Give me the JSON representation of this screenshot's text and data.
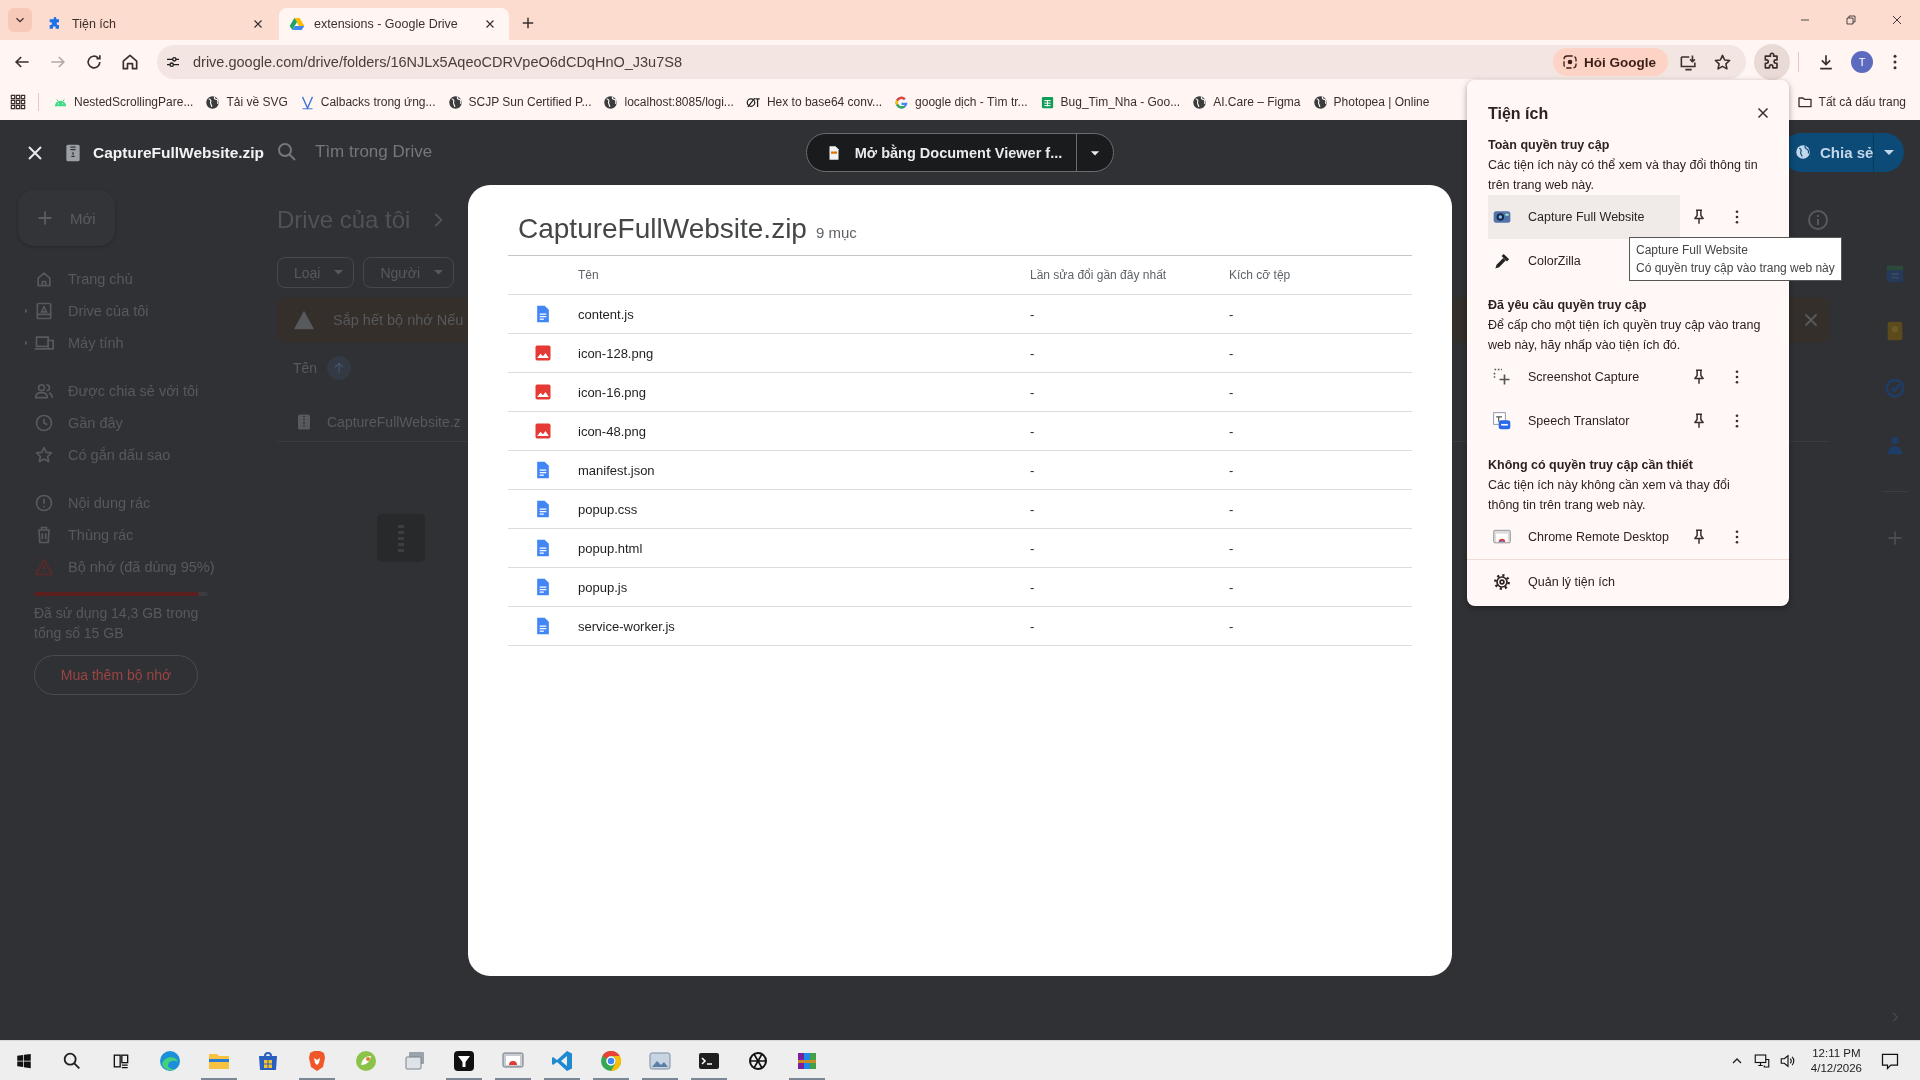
{
  "browser": {
    "tabs": [
      {
        "title": "Tiện ích",
        "selected": false
      },
      {
        "title": "extensions - Google Drive",
        "selected": true
      }
    ],
    "url": "drive.google.com/drive/folders/16NJLx5AqeoCDRVpeO6dCDqHnO_J3u7S8",
    "ask_google": "Hỏi Google",
    "profile_initial": "T",
    "bookmarks": [
      "NestedScrollingPare...",
      "Tải về SVG",
      "Calbacks trong ứng...",
      "SCJP Sun Certified P...",
      "localhost:8085/logi...",
      "Hex to base64 conv...",
      "google dịch - Tìm tr...",
      "Bug_Tim_Nha - Goo...",
      "AI.Care – Figma",
      "Photopea | Online"
    ],
    "all_bookmarks": "Tất cả dấu trang"
  },
  "drive": {
    "new_button": "Mới",
    "search_placeholder": "Tìm trong Drive",
    "share": "Chia sẻ",
    "nav_groups": [
      [
        {
          "label": "Trang chủ",
          "expandable": false
        },
        {
          "label": "Drive của tôi",
          "expandable": true
        },
        {
          "label": "Máy tính",
          "expandable": true
        }
      ],
      [
        {
          "label": "Được chia sẻ với tôi",
          "expandable": false
        },
        {
          "label": "Gần đây",
          "expandable": false
        },
        {
          "label": "Có gắn dấu sao",
          "expandable": false
        }
      ],
      [
        {
          "label": "Nội dung rác",
          "expandable": false
        },
        {
          "label": "Thùng rác",
          "expandable": false
        },
        {
          "label": "Bộ nhớ (đã dùng 95%)",
          "expandable": false
        }
      ]
    ],
    "storage": {
      "level": 0.95,
      "text": "Đã sử dụng 14,3 GB trong tổng số 15 GB"
    },
    "buy_storage": "Mua thêm bộ nhớ",
    "heading": "Drive của tôi",
    "filters": [
      "Loại",
      "Người"
    ],
    "banner": "Sắp hết bộ nhớ Nếu",
    "sort_label": "Tên",
    "files": [
      "CaptureFullWebsite.z"
    ]
  },
  "viewer": {
    "file_name": "CaptureFullWebsite.zip",
    "open_with": "Mở bằng Document Viewer f..."
  },
  "archive": {
    "title": "CaptureFullWebsite.zip",
    "count": "9 mục",
    "columns": [
      "Tên",
      "Lần sửa đổi gần đây nhất",
      "Kích cỡ tệp"
    ],
    "rows": [
      {
        "kind": "document",
        "name": "content.js",
        "modified": "-",
        "size": "-"
      },
      {
        "kind": "image",
        "name": "icon-128.png",
        "modified": "-",
        "size": "-"
      },
      {
        "kind": "image",
        "name": "icon-16.png",
        "modified": "-",
        "size": "-"
      },
      {
        "kind": "image",
        "name": "icon-48.png",
        "modified": "-",
        "size": "-"
      },
      {
        "kind": "document",
        "name": "manifest.json",
        "modified": "-",
        "size": "-"
      },
      {
        "kind": "document",
        "name": "popup.css",
        "modified": "-",
        "size": "-"
      },
      {
        "kind": "document",
        "name": "popup.html",
        "modified": "-",
        "size": "-"
      },
      {
        "kind": "document",
        "name": "popup.js",
        "modified": "-",
        "size": "-"
      },
      {
        "kind": "document",
        "name": "service-worker.js",
        "modified": "-",
        "size": "-"
      }
    ]
  },
  "extensions_menu": {
    "title": "Tiện ích",
    "sections": [
      {
        "heading": "Toàn quyền truy cập",
        "description": "Các tiện ích này có thể xem và thay đổi thông tin trên trang web này.",
        "items": [
          {
            "name": "Capture Full Website",
            "selected": true
          },
          {
            "name": "ColorZilla",
            "selected": false
          }
        ]
      },
      {
        "heading": "Đã yêu cầu quyền truy cập",
        "description": "Để cấp cho một tiện ích quyền truy cập vào trang web này, hãy nhấp vào tiện ích đó.",
        "items": [
          {
            "name": "Screenshot Capture",
            "selected": false
          },
          {
            "name": "Speech Translator",
            "selected": false
          }
        ]
      },
      {
        "heading": "Không có quyền truy cập cần thiết",
        "description": "Các tiện ích này không cần xem và thay đổi thông tin trên trang web này.",
        "items": [
          {
            "name": "Chrome Remote Desktop",
            "selected": false
          }
        ]
      }
    ],
    "manage": "Quản lý tiện ích",
    "tooltip": {
      "title": "Capture Full Website",
      "text": "Có quyền truy cập vào trang web này"
    }
  },
  "taskbar": {
    "apps": [
      {
        "running": false
      },
      {
        "running": true
      },
      {
        "running": false
      },
      {
        "running": true
      },
      {
        "running": false
      },
      {
        "running": false
      },
      {
        "running": true
      },
      {
        "running": true
      },
      {
        "running": true
      },
      {
        "running": true
      },
      {
        "running": true
      },
      {
        "running": true
      },
      {
        "running": false
      },
      {
        "running": true
      }
    ],
    "time": "12:11 PM",
    "date": "4/12/2026"
  }
}
